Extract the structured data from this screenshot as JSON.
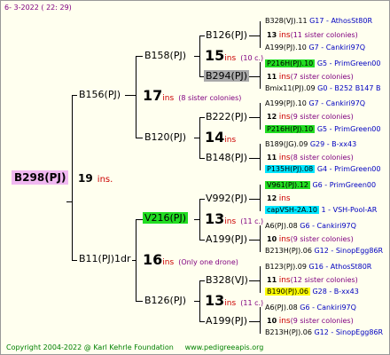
{
  "header": {
    "date": "6-  3-2022 ( 22: 29)"
  },
  "footer": {
    "copyright": "Copyright 2004-2022 @ Karl Kehrle Foundation",
    "site": "www.pedigreeapis.org"
  },
  "root": {
    "name": "B298(PJ)",
    "num": "19",
    "ins": "ins."
  },
  "gen1": [
    {
      "name": "B156(PJ)",
      "num": "17",
      "ins": "ins",
      "note": "(8 sister colonies)"
    },
    {
      "name": "B11(PJ)1dr",
      "num": "16",
      "ins": "ins",
      "note": "(Only one drone)"
    }
  ],
  "gen2": [
    {
      "name": "B158(PJ)",
      "num": "15",
      "ins": "ins",
      "note": "(10 c.)"
    },
    {
      "name": "B120(PJ)",
      "num": "14",
      "ins": "ins",
      "note": ""
    },
    {
      "name": "V216(PJ)",
      "num": "13",
      "ins": "ins",
      "note": "(11 c.)"
    },
    {
      "name": "B126(PJ)",
      "num": "13",
      "ins": "ins",
      "note": "(11 c.)"
    }
  ],
  "gen3": [
    {
      "name": "B126(PJ)"
    },
    {
      "name": "B294(PJ)"
    },
    {
      "name": "B222(PJ)"
    },
    {
      "name": "B148(PJ)"
    },
    {
      "name": "V992(PJ)"
    },
    {
      "name": "A199(PJ)"
    },
    {
      "name": "B328(VJ)"
    },
    {
      "name": "A199(PJ)"
    }
  ],
  "gen4": [
    {
      "top": "B328(VJ).11",
      "topinfo": "G17 - AthosSt80R",
      "num": "13",
      "ins": "ins",
      "note": "(11 sister colonies)",
      "bot": "A199(PJ).10",
      "botinfo": "G7 - Cankiri97Q"
    },
    {
      "top": "P216H(PJ).10",
      "topinfo": "G5 - PrimGreen00",
      "num": "11",
      "ins": "ins",
      "note": "(7 sister colonies)",
      "bot": "Bmix11(PJ).09",
      "botinfo": "G0 - B252 B147 B"
    },
    {
      "top": "A199(PJ).10",
      "topinfo": "G7 - Cankiri97Q",
      "num": "12",
      "ins": "ins",
      "note": "(9 sister colonies)",
      "bot": "P216H(PJ).10",
      "botinfo": "G5 - PrimGreen00"
    },
    {
      "top": "B189(JG).09",
      "topinfo": "G29 - B-xx43",
      "num": "11",
      "ins": "ins",
      "note": "(8 sister colonies)",
      "bot": "P135H(PJ).08",
      "botinfo": "G4 - PrimGreen00"
    },
    {
      "top": "V961(PJ).12",
      "topinfo": "G6 - PrimGreen00",
      "num": "12",
      "ins": "ins",
      "note": "",
      "bot": "capVSH-2A.10",
      "botinfo": "1 - VSH-Pool-AR"
    },
    {
      "top": "A6(PJ).08",
      "topinfo": "G6 - Cankiri97Q",
      "num": "10",
      "ins": "ins",
      "note": "(9 sister colonies)",
      "bot": "B213H(PJ).06",
      "botinfo": "G12 - SinopEgg86R"
    },
    {
      "top": "B123(PJ).09",
      "topinfo": "G16 - AthosSt80R",
      "num": "11",
      "ins": "ins",
      "note": "(12 sister colonies)",
      "bot": "B190(PJ).06",
      "botinfo": "G28 - B-xx43"
    },
    {
      "top": "A6(PJ).08",
      "topinfo": "G6 - Cankiri97Q",
      "num": "10",
      "ins": "ins",
      "note": "(9 sister colonies)",
      "bot": "B213H(PJ).06",
      "botinfo": "G12 - SinopEgg86R"
    }
  ]
}
